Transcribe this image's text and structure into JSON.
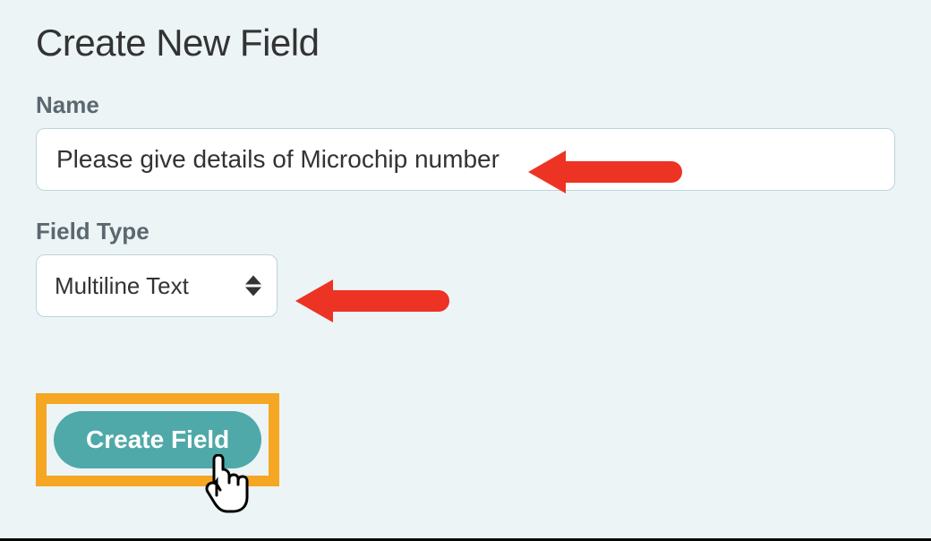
{
  "title": "Create New Field",
  "nameField": {
    "label": "Name",
    "value": "Please give details of Microchip number"
  },
  "typeField": {
    "label": "Field Type",
    "value": "Multiline Text"
  },
  "submit": {
    "label": "Create Field"
  }
}
